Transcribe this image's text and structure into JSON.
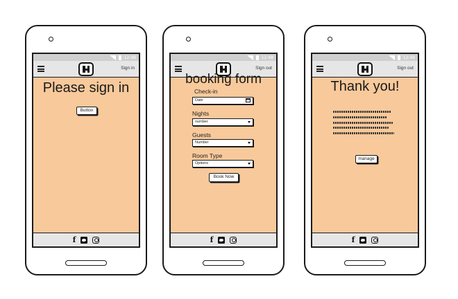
{
  "screens": [
    {
      "nav_link": "Sign in",
      "heading": "Please sign in",
      "button_label": "Button"
    },
    {
      "nav_link": "Sign out",
      "heading": "booking form",
      "fields": [
        {
          "label": "Check-in",
          "value": "Date",
          "icon": "calendar-icon"
        },
        {
          "label": "Nights",
          "value": "number",
          "icon": "chevron-down-icon"
        },
        {
          "label": "Guests",
          "value": "Number",
          "icon": "chevron-down-icon"
        },
        {
          "label": "Room Type",
          "value": "Options",
          "icon": "chevron-down-icon"
        }
      ],
      "button_label": "Book Now"
    },
    {
      "nav_link": "Sign out",
      "heading": "Thank you!",
      "button_label": "manage"
    }
  ],
  "status_bar": {
    "time": "12:48"
  },
  "logo_letter": "H",
  "footer_icons": [
    "facebook-icon",
    "twitter-icon",
    "instagram-icon"
  ],
  "colors": {
    "screen_bg": "#f8c99b",
    "bar_bg": "#e6e6e6"
  }
}
